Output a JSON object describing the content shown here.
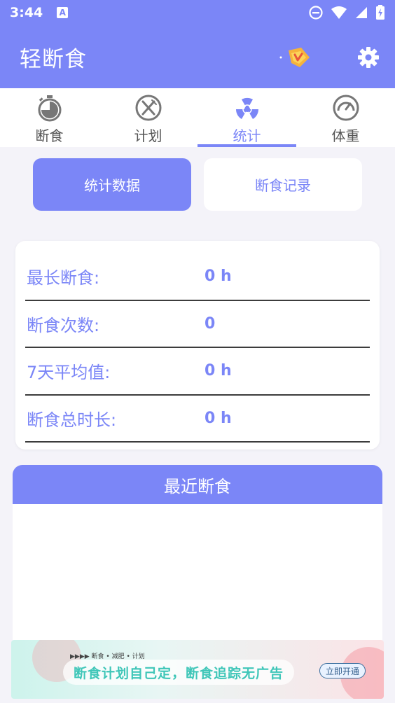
{
  "status_bar": {
    "time": "3:44",
    "a_icon_label": "A"
  },
  "app_bar": {
    "title": "轻断食"
  },
  "tabs": [
    {
      "label": "断食",
      "icon": "stopwatch-icon",
      "active": false
    },
    {
      "label": "计划",
      "icon": "fork-knife-icon",
      "active": false
    },
    {
      "label": "统计",
      "icon": "radiation-icon",
      "active": true
    },
    {
      "label": "体重",
      "icon": "gauge-icon",
      "active": false
    }
  ],
  "segments": {
    "stats_label": "统计数据",
    "records_label": "断食记录"
  },
  "stats": [
    {
      "label": "最长断食:",
      "value": "0 h"
    },
    {
      "label": "断食次数:",
      "value": "0"
    },
    {
      "label": "7天平均值:",
      "value": "0 h"
    },
    {
      "label": "断食总时长:",
      "value": "0 h"
    }
  ],
  "recent": {
    "title": "最近断食"
  },
  "ad": {
    "small_text": "▶▶▶▶   断食 • 减肥 • 计划",
    "main_text": "断食计划自己定，断食追踪无广告",
    "cta": "立即开通"
  },
  "colors": {
    "accent": "#7b86f7",
    "divider": "#3c3c3c",
    "background": "#f4f3f9"
  }
}
